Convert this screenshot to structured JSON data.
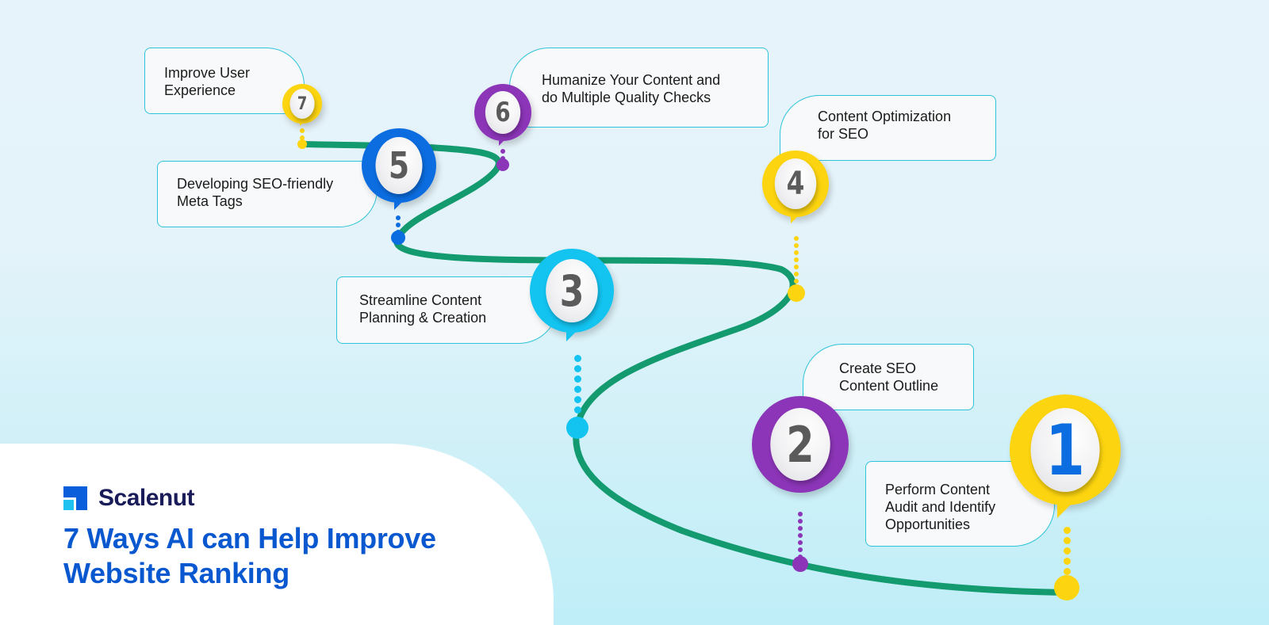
{
  "brand": {
    "name": "Scalenut",
    "logo_icon": "scalenut-logo-icon"
  },
  "title": "7 Ways AI can Help Improve Website Ranking",
  "colors": {
    "road": "#139a6f",
    "yellow": "#fcd40f",
    "purple": "#8c35b8",
    "cyan": "#13c3f0",
    "blue": "#0b6de0",
    "card_border": "#2fc3da",
    "title": "#0a58d0",
    "brand_dark": "#1a1c5a"
  },
  "steps": [
    {
      "number": "1",
      "label_line1": "Perform Content",
      "label_line2": "Audit and Identify",
      "label_line3": "Opportunities",
      "color": "yellow"
    },
    {
      "number": "2",
      "label_line1": "Create SEO",
      "label_line2": "Content Outline",
      "color": "purple"
    },
    {
      "number": "3",
      "label_line1": "Streamline Content",
      "label_line2": "Planning & Creation",
      "color": "cyan"
    },
    {
      "number": "4",
      "label_line1": "Content Optimization",
      "label_line2": "for SEO",
      "color": "yellow"
    },
    {
      "number": "5",
      "label_line1": "Developing SEO-friendly",
      "label_line2": "Meta Tags",
      "color": "blue"
    },
    {
      "number": "6",
      "label_line1": "Humanize Your Content and",
      "label_line2": "do Multiple Quality Checks",
      "color": "purple"
    },
    {
      "number": "7",
      "label_line1": "Improve User",
      "label_line2": "Experience",
      "color": "yellow"
    }
  ]
}
